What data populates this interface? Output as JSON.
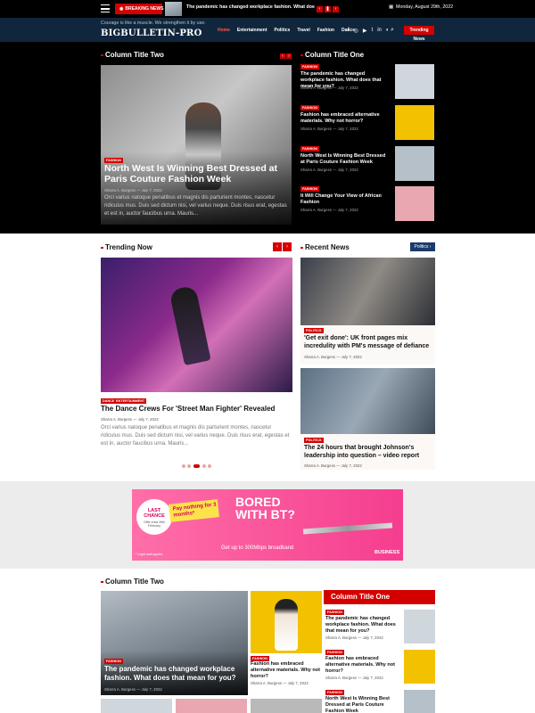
{
  "topbar": {
    "breaking_label": "BREAKING NEWS",
    "breaking_headline": "The pandemic has changed workplace fashion. What does that mean for you?",
    "date": "Monday, August 29th, 2022"
  },
  "header": {
    "tagline": "Courage is like a muscle. We strengthen it by use.",
    "logo": "BIGBULLETIN-PRO",
    "nav": [
      "Home",
      "Entertainment",
      "Politics",
      "Travel",
      "Fashion",
      "Dance"
    ],
    "social": [
      "f",
      "◎",
      "▶",
      "t",
      "in",
      "◐"
    ],
    "trending_button": "Trending News"
  },
  "top_section": {
    "left_title": "Column Title Two",
    "right_title": "Column Title One",
    "featured": {
      "tag": "FASHION",
      "title": "North West Is Winning Best Dressed at Paris Couture Fashion Week",
      "author": "Sharra A. Burgess",
      "date": "July 7, 2022",
      "excerpt": "Orci varius natoque penatibus et magnis dis parturient montes, nascetur ridiculus mus. Duis sed dictum nisi, vel varius neque. Duis risus erat, egestas et est in, auctor faucibus urna. Mauris..."
    },
    "list": [
      {
        "tag": "FASHION",
        "title": "The pandemic has changed workplace fashion. What does that mean for you?",
        "author": "Sharra A. Burgess",
        "date": "July 7, 2022",
        "color": "#cfd6dc"
      },
      {
        "tag": "FASHION",
        "title": "Fashion has embraced alternative materials. Why not horror?",
        "author": "Sharra A. Burgess",
        "date": "July 7, 2022",
        "color": "#f2c200"
      },
      {
        "tag": "FASHION",
        "title": "North West Is Winning Best Dressed at Paris Couture Fashion Week",
        "author": "Sharra A. Burgess",
        "date": "July 7, 2022",
        "color": "#b6c0c9"
      },
      {
        "tag": "FASHION",
        "title": "It Will Change Your View of African Fashion",
        "author": "Sharra A. Burgess",
        "date": "July 7, 2022",
        "color": "#e9a7b1"
      }
    ]
  },
  "trending": {
    "title": "Trending Now",
    "tags": [
      "DANCE",
      "ENTERTAINMENT"
    ],
    "headline": "The Dance Crews For 'Street Man Fighter' Revealed",
    "author": "Sharra A. Burgess",
    "date": "July 7, 2022",
    "excerpt": "Orci varius natoque penatibus et magnis dis parturient montes, nascetur ridiculus mus. Duis sed dictum nisi, vel varius neque. Duis risus erat, egestas et est in, auctor faucibus urna. Mauris..."
  },
  "recent": {
    "title": "Recent News",
    "filter": "Politics",
    "items": [
      {
        "tag": "POLITICS",
        "title": "'Get exit done': UK front pages mix incredulity with PM's message of defiance",
        "author": "Sharra A. Burgess",
        "date": "July 7, 2022"
      },
      {
        "tag": "POLITICS",
        "title": "The 24 hours that brought Johnson's leadership into question – video report",
        "author": "Sharra A. Burgess",
        "date": "July 7, 2022"
      }
    ]
  },
  "ad": {
    "last_chance": "LAST CHANCE",
    "offer_ends": "Offer ends 26th February",
    "pay_nothing": "Pay nothing for 3 months*",
    "bored": "BORED WITH BT?",
    "speed": "Get up to 300Mbps broadband",
    "brand": "BUSINESS",
    "legal": "* Legal stuff applies"
  },
  "bottom": {
    "left_title": "Column Title Two",
    "right_title": "Column Title One",
    "feature": {
      "tag": "FASHION",
      "title": "The pandemic has changed workplace fashion. What does that mean for you?",
      "author": "Sharra A. Burgess",
      "date": "July 7, 2022"
    },
    "mid": {
      "tag": "FASHION",
      "title": "Fashion has embraced alternative materials. Why not horror?",
      "author": "Sharra A. Burgess",
      "date": "July 7, 2022"
    },
    "list": [
      {
        "tag": "FASHION",
        "title": "The pandemic has changed workplace fashion. What does that mean for you?",
        "author": "Sharra A. Burgess",
        "date": "July 7, 2022",
        "color": "#cfd6dc"
      },
      {
        "tag": "FASHION",
        "title": "Fashion has embraced alternative materials. Why not horror?",
        "author": "Sharra A. Burgess",
        "date": "July 7, 2022",
        "color": "#f2c200"
      },
      {
        "tag": "FASHION",
        "title": "North West Is Winning Best Dressed at Paris Couture Fashion Week",
        "author": "",
        "date": "",
        "color": "#b6c0c9"
      }
    ]
  }
}
